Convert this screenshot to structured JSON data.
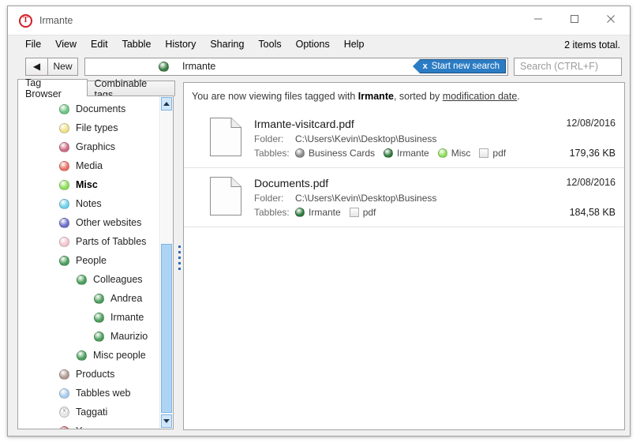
{
  "window": {
    "title": "Irmante",
    "app_icon": "tabbles-logo-icon",
    "minimize": "minimize-icon",
    "maximize": "maximize-icon",
    "close": "close-icon"
  },
  "menu": {
    "items": [
      "File",
      "View",
      "Edit",
      "Tabble",
      "History",
      "Sharing",
      "Tools",
      "Options",
      "Help"
    ],
    "items_total": "2 items total."
  },
  "toolbar": {
    "back_label": "◀",
    "new_label": "New",
    "path_label": "Irmante",
    "path_dot_color": "#3a7d44",
    "start_new_search": {
      "x": "x",
      "label": "Start new search"
    },
    "search_placeholder": "Search (CTRL+F)",
    "search_value": ""
  },
  "left_pane": {
    "tabs": [
      {
        "label": "Tag Browser",
        "active": true
      },
      {
        "label": "Combinable tags",
        "active": false
      }
    ],
    "tree": [
      {
        "label": "Documents",
        "indent": 0,
        "color": "#6ec483",
        "bold": false,
        "type": "dot"
      },
      {
        "label": "File types",
        "indent": 0,
        "color": "#efe08a",
        "bold": false,
        "type": "dot"
      },
      {
        "label": "Graphics",
        "indent": 0,
        "color": "#cc6e85",
        "bold": false,
        "type": "dot"
      },
      {
        "label": "Media",
        "indent": 0,
        "color": "#ea7166",
        "bold": false,
        "type": "dot"
      },
      {
        "label": "Misc",
        "indent": 0,
        "color": "#8ede5a",
        "bold": true,
        "type": "dot"
      },
      {
        "label": "Notes",
        "indent": 0,
        "color": "#6fd0ea",
        "bold": false,
        "type": "dot"
      },
      {
        "label": "Other websites",
        "indent": 0,
        "color": "#6d6ec9",
        "bold": false,
        "type": "dot"
      },
      {
        "label": "Parts of Tabbles",
        "indent": 0,
        "color": "#f3c6cf",
        "bold": false,
        "type": "dot"
      },
      {
        "label": "People",
        "indent": 0,
        "color": "#4c9e5c",
        "bold": false,
        "type": "dot"
      },
      {
        "label": "Colleagues",
        "indent": 1,
        "color": "#4c9e5c",
        "bold": false,
        "type": "dot"
      },
      {
        "label": "Andrea",
        "indent": 2,
        "color": "#4c9e5c",
        "bold": false,
        "type": "dot"
      },
      {
        "label": "Irmante",
        "indent": 2,
        "color": "#4c9e5c",
        "bold": false,
        "type": "dot"
      },
      {
        "label": "Maurizio",
        "indent": 2,
        "color": "#4c9e5c",
        "bold": false,
        "type": "dot"
      },
      {
        "label": "Misc people",
        "indent": 1,
        "color": "#4c9e5c",
        "bold": false,
        "type": "dot"
      },
      {
        "label": "Products",
        "indent": 0,
        "color": "#b09a93",
        "bold": false,
        "type": "dot"
      },
      {
        "label": "Tabbles web",
        "indent": 0,
        "color": "#a9cdee",
        "bold": false,
        "type": "dot"
      },
      {
        "label": "Taggati",
        "indent": 0,
        "color": "#dcdcdc",
        "bold": false,
        "type": "special"
      },
      {
        "label": "Years",
        "indent": 0,
        "color": "#cc5f6b",
        "bold": false,
        "type": "dot"
      }
    ]
  },
  "results": {
    "header": {
      "prefix": "You are now viewing files tagged with ",
      "tag": "Irmante",
      "middle": ", sorted by ",
      "sort_link": "modification date",
      "suffix": "."
    },
    "labels": {
      "folder": "Folder:",
      "tabbles": "Tabbles:"
    },
    "files": [
      {
        "name": "Irmante-visitcard.pdf",
        "folder": "C:\\Users\\Kevin\\Desktop\\Business",
        "date": "12/08/2016",
        "size": "179,36 KB",
        "tags": [
          {
            "label": "Business Cards",
            "color": "#8a8a8a",
            "type": "dot"
          },
          {
            "label": "Irmante",
            "color": "#2e7a3e",
            "type": "dot"
          },
          {
            "label": "Misc",
            "color": "#8ede5a",
            "type": "dot"
          },
          {
            "label": "pdf",
            "color": "#e6e6e6",
            "type": "square"
          }
        ]
      },
      {
        "name": "Documents.pdf",
        "folder": "C:\\Users\\Kevin\\Desktop\\Business",
        "date": "12/08/2016",
        "size": "184,58 KB",
        "tags": [
          {
            "label": "Irmante",
            "color": "#2e7a3e",
            "type": "dot"
          },
          {
            "label": "pdf",
            "color": "#e6e6e6",
            "type": "square"
          }
        ]
      }
    ]
  }
}
